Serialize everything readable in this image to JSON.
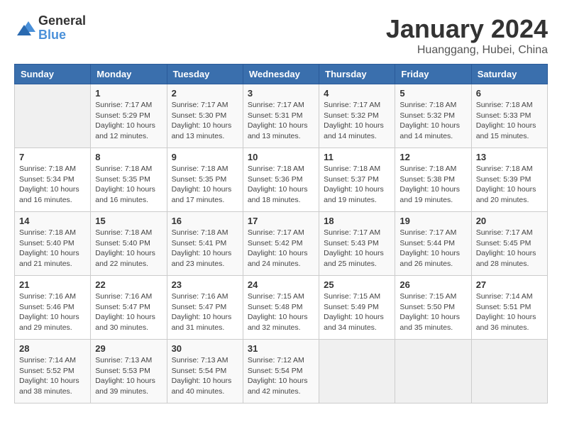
{
  "logo": {
    "general": "General",
    "blue": "Blue"
  },
  "title": "January 2024",
  "subtitle": "Huanggang, Hubei, China",
  "weekdays": [
    "Sunday",
    "Monday",
    "Tuesday",
    "Wednesday",
    "Thursday",
    "Friday",
    "Saturday"
  ],
  "weeks": [
    [
      {
        "day": "",
        "info": ""
      },
      {
        "day": "1",
        "info": "Sunrise: 7:17 AM\nSunset: 5:29 PM\nDaylight: 10 hours\nand 12 minutes."
      },
      {
        "day": "2",
        "info": "Sunrise: 7:17 AM\nSunset: 5:30 PM\nDaylight: 10 hours\nand 13 minutes."
      },
      {
        "day": "3",
        "info": "Sunrise: 7:17 AM\nSunset: 5:31 PM\nDaylight: 10 hours\nand 13 minutes."
      },
      {
        "day": "4",
        "info": "Sunrise: 7:17 AM\nSunset: 5:32 PM\nDaylight: 10 hours\nand 14 minutes."
      },
      {
        "day": "5",
        "info": "Sunrise: 7:18 AM\nSunset: 5:32 PM\nDaylight: 10 hours\nand 14 minutes."
      },
      {
        "day": "6",
        "info": "Sunrise: 7:18 AM\nSunset: 5:33 PM\nDaylight: 10 hours\nand 15 minutes."
      }
    ],
    [
      {
        "day": "7",
        "info": "Sunrise: 7:18 AM\nSunset: 5:34 PM\nDaylight: 10 hours\nand 16 minutes."
      },
      {
        "day": "8",
        "info": "Sunrise: 7:18 AM\nSunset: 5:35 PM\nDaylight: 10 hours\nand 16 minutes."
      },
      {
        "day": "9",
        "info": "Sunrise: 7:18 AM\nSunset: 5:35 PM\nDaylight: 10 hours\nand 17 minutes."
      },
      {
        "day": "10",
        "info": "Sunrise: 7:18 AM\nSunset: 5:36 PM\nDaylight: 10 hours\nand 18 minutes."
      },
      {
        "day": "11",
        "info": "Sunrise: 7:18 AM\nSunset: 5:37 PM\nDaylight: 10 hours\nand 19 minutes."
      },
      {
        "day": "12",
        "info": "Sunrise: 7:18 AM\nSunset: 5:38 PM\nDaylight: 10 hours\nand 19 minutes."
      },
      {
        "day": "13",
        "info": "Sunrise: 7:18 AM\nSunset: 5:39 PM\nDaylight: 10 hours\nand 20 minutes."
      }
    ],
    [
      {
        "day": "14",
        "info": "Sunrise: 7:18 AM\nSunset: 5:40 PM\nDaylight: 10 hours\nand 21 minutes."
      },
      {
        "day": "15",
        "info": "Sunrise: 7:18 AM\nSunset: 5:40 PM\nDaylight: 10 hours\nand 22 minutes."
      },
      {
        "day": "16",
        "info": "Sunrise: 7:18 AM\nSunset: 5:41 PM\nDaylight: 10 hours\nand 23 minutes."
      },
      {
        "day": "17",
        "info": "Sunrise: 7:17 AM\nSunset: 5:42 PM\nDaylight: 10 hours\nand 24 minutes."
      },
      {
        "day": "18",
        "info": "Sunrise: 7:17 AM\nSunset: 5:43 PM\nDaylight: 10 hours\nand 25 minutes."
      },
      {
        "day": "19",
        "info": "Sunrise: 7:17 AM\nSunset: 5:44 PM\nDaylight: 10 hours\nand 26 minutes."
      },
      {
        "day": "20",
        "info": "Sunrise: 7:17 AM\nSunset: 5:45 PM\nDaylight: 10 hours\nand 28 minutes."
      }
    ],
    [
      {
        "day": "21",
        "info": "Sunrise: 7:16 AM\nSunset: 5:46 PM\nDaylight: 10 hours\nand 29 minutes."
      },
      {
        "day": "22",
        "info": "Sunrise: 7:16 AM\nSunset: 5:47 PM\nDaylight: 10 hours\nand 30 minutes."
      },
      {
        "day": "23",
        "info": "Sunrise: 7:16 AM\nSunset: 5:47 PM\nDaylight: 10 hours\nand 31 minutes."
      },
      {
        "day": "24",
        "info": "Sunrise: 7:15 AM\nSunset: 5:48 PM\nDaylight: 10 hours\nand 32 minutes."
      },
      {
        "day": "25",
        "info": "Sunrise: 7:15 AM\nSunset: 5:49 PM\nDaylight: 10 hours\nand 34 minutes."
      },
      {
        "day": "26",
        "info": "Sunrise: 7:15 AM\nSunset: 5:50 PM\nDaylight: 10 hours\nand 35 minutes."
      },
      {
        "day": "27",
        "info": "Sunrise: 7:14 AM\nSunset: 5:51 PM\nDaylight: 10 hours\nand 36 minutes."
      }
    ],
    [
      {
        "day": "28",
        "info": "Sunrise: 7:14 AM\nSunset: 5:52 PM\nDaylight: 10 hours\nand 38 minutes."
      },
      {
        "day": "29",
        "info": "Sunrise: 7:13 AM\nSunset: 5:53 PM\nDaylight: 10 hours\nand 39 minutes."
      },
      {
        "day": "30",
        "info": "Sunrise: 7:13 AM\nSunset: 5:54 PM\nDaylight: 10 hours\nand 40 minutes."
      },
      {
        "day": "31",
        "info": "Sunrise: 7:12 AM\nSunset: 5:54 PM\nDaylight: 10 hours\nand 42 minutes."
      },
      {
        "day": "",
        "info": ""
      },
      {
        "day": "",
        "info": ""
      },
      {
        "day": "",
        "info": ""
      }
    ]
  ]
}
